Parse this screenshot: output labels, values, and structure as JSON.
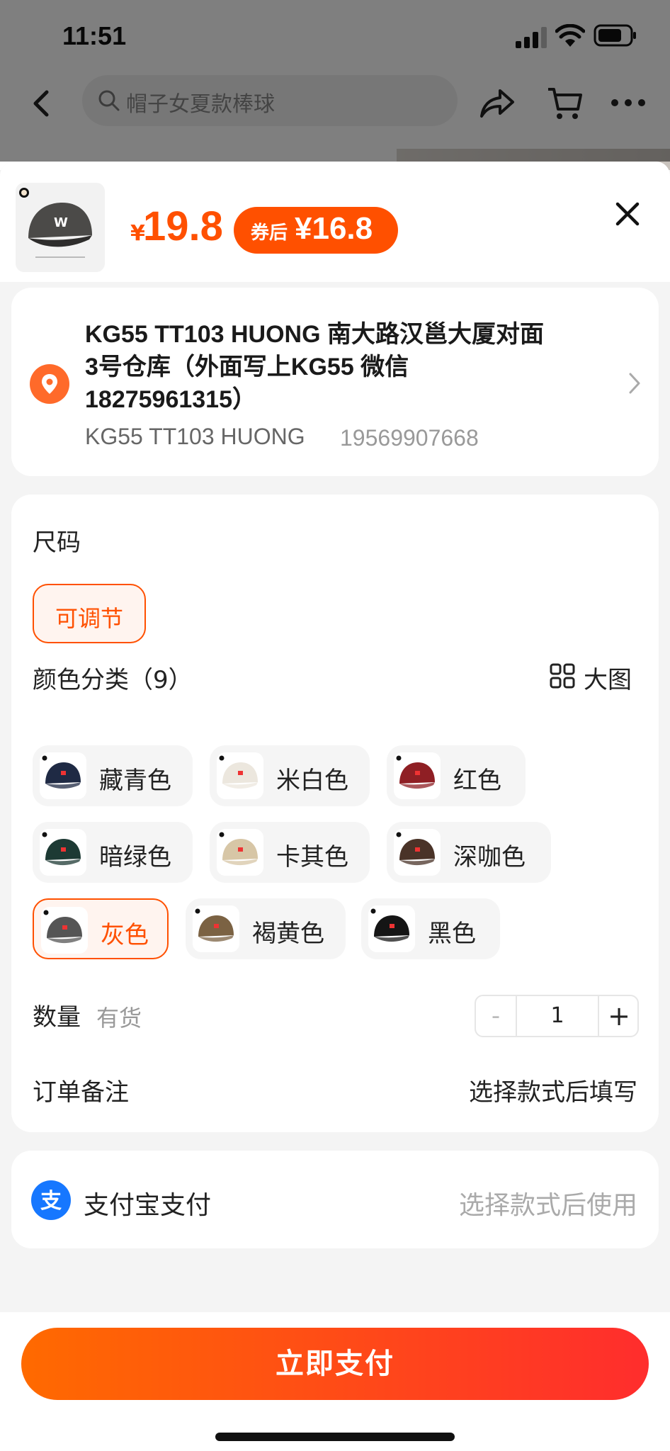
{
  "status_bar": {
    "time": "11:51"
  },
  "nav": {
    "search_text": "帽子女夏款棒球"
  },
  "product": {
    "price_symbol": "¥",
    "price": "19.8",
    "coupon_label": "券后",
    "coupon_price": "¥16.8"
  },
  "address": {
    "line1": "KG55  TT103 HUONG 南大路汉邕大厦对面",
    "line2": "3号仓库（外面写上KG55 微信",
    "line3": "18275961315）",
    "name": "KG55 TT103 HUONG",
    "phone": "19569907668"
  },
  "size": {
    "label": "尺码",
    "options": [
      "可调节"
    ],
    "selected": "可调节"
  },
  "color": {
    "label": "颜色分类（9）",
    "big_view_label": "大图",
    "options": [
      {
        "label": "藏青色",
        "swatch": "#1f2a44"
      },
      {
        "label": "米白色",
        "swatch": "#ece7de"
      },
      {
        "label": "红色",
        "swatch": "#8f1f24"
      },
      {
        "label": "暗绿色",
        "swatch": "#1d3a34"
      },
      {
        "label": "卡其色",
        "swatch": "#d7c6a6"
      },
      {
        "label": "深咖色",
        "swatch": "#4a3328"
      },
      {
        "label": "灰色",
        "swatch": "#555555",
        "selected": true
      },
      {
        "label": "褐黄色",
        "swatch": "#7b6243"
      },
      {
        "label": "黑色",
        "swatch": "#151515"
      }
    ]
  },
  "quantity": {
    "label": "数量",
    "stock": "有货",
    "minus": "-",
    "value": "1",
    "plus": "+"
  },
  "note": {
    "label": "订单备注",
    "hint": "选择款式后填写"
  },
  "payment": {
    "label": "支付宝支付",
    "hint": "选择款式后使用"
  },
  "action": {
    "pay_button": "立即支付"
  },
  "colors": {
    "accent": "#ff5000",
    "button_start": "#ff6a00",
    "button_end": "#ff2d2d",
    "alipay": "#1677ff"
  }
}
